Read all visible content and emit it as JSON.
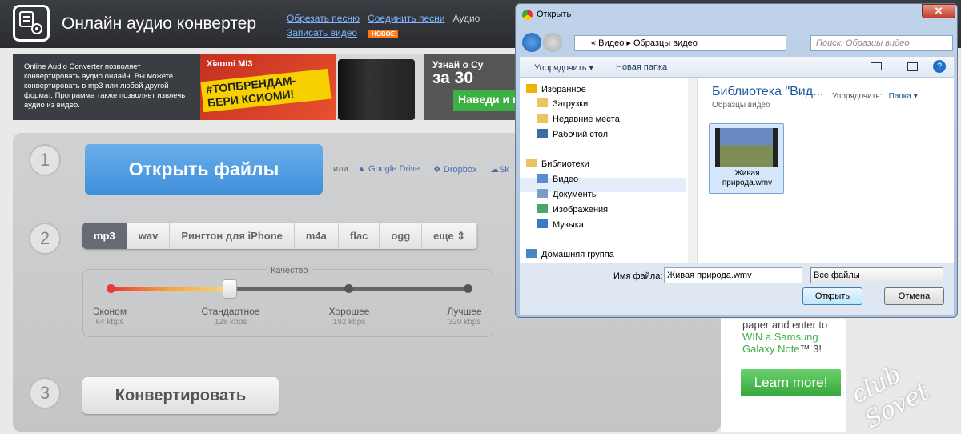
{
  "app": {
    "title": "Онлайн аудио конвертер"
  },
  "toplinks": {
    "cut": "Обрезать песню",
    "join": "Соединить песни",
    "audio": "Аудио ",
    "record": "Записать видео",
    "badge": "НОВОЕ"
  },
  "info": {
    "text": "Online Audio Converter позволяет конвертировать аудио онлайн. Вы можете конвертировать в mp3 или любой другой формат. Программа также позволяет извлечь аудио из видео."
  },
  "banner": {
    "brand": "Xiaomi MI3",
    "slogan1": "#ТОПБРЕНДАМ-",
    "slogan2": "БЕРИ КСИОМИ!",
    "right1": "Узнай о Су",
    "right2": "за 30",
    "button": "Наведи и п"
  },
  "steps": {
    "s1": "1",
    "s2": "2",
    "s3": "3"
  },
  "open": {
    "label": "Открыть файлы",
    "or": "или",
    "gdrive": "Google Drive",
    "dropbox": "Dropbox",
    "sky": "Sk"
  },
  "formats": [
    "mp3",
    "wav",
    "Рингтон для iPhone",
    "m4a",
    "flac",
    "ogg",
    "еще ⇕"
  ],
  "quality": {
    "label": "Качество",
    "level": 0.333,
    "levels": [
      {
        "name": "Эконом",
        "kbps": "64 kbps"
      },
      {
        "name": "Стандартное",
        "kbps": "128 kbps"
      },
      {
        "name": "Хорошее",
        "kbps": "192 kbps"
      },
      {
        "name": "Лучшее",
        "kbps": "320 kbps"
      }
    ]
  },
  "convert": {
    "label": "Конвертировать"
  },
  "ad": {
    "line1": "paper and enter to",
    "line2": "WIN a Samsung",
    "line3": "Galaxy Note",
    "line3b": "™ 3!",
    "button": "Learn more!"
  },
  "watermark": "club Sovet",
  "dialog": {
    "title": "Открыть",
    "close": "✕",
    "address": "«  Видео  ▸  Образцы видео",
    "search": "Поиск: Образцы видео",
    "toolbar": {
      "arrange": "Упорядочить ▾",
      "newfolder": "Новая папка"
    },
    "nav": [
      {
        "label": "Избранное",
        "icon": "star-icon"
      },
      {
        "label": "Загрузки",
        "icon": "downloads-folder-icon"
      },
      {
        "label": "Недавние места",
        "icon": "recent-places-icon"
      },
      {
        "label": "Рабочий стол",
        "icon": "desktop-icon"
      },
      {
        "label": "Библиотеки",
        "icon": "libraries-icon"
      },
      {
        "label": "Видео",
        "icon": "video-library-icon"
      },
      {
        "label": "Документы",
        "icon": "documents-icon"
      },
      {
        "label": "Изображения",
        "icon": "pictures-icon"
      },
      {
        "label": "Музыка",
        "icon": "music-icon"
      },
      {
        "label": "Домашняя группа",
        "icon": "homegroup-icon"
      }
    ],
    "lib_title": "Библиотека \"Вид...",
    "lib_sub": "Образцы видео",
    "arrange_label": "Упорядочить:",
    "arrange_value": "Папка ▾",
    "file": {
      "name": "Живая природа.wmv"
    },
    "filename_label": "Имя файла:",
    "filename_value": "Живая природа.wmv",
    "filetype": "Все файлы",
    "open_btn": "Открыть",
    "cancel_btn": "Отмена"
  },
  "colors": {
    "accent": "#4a9ae6",
    "header": "#2f3236",
    "green": "#3cb043"
  }
}
